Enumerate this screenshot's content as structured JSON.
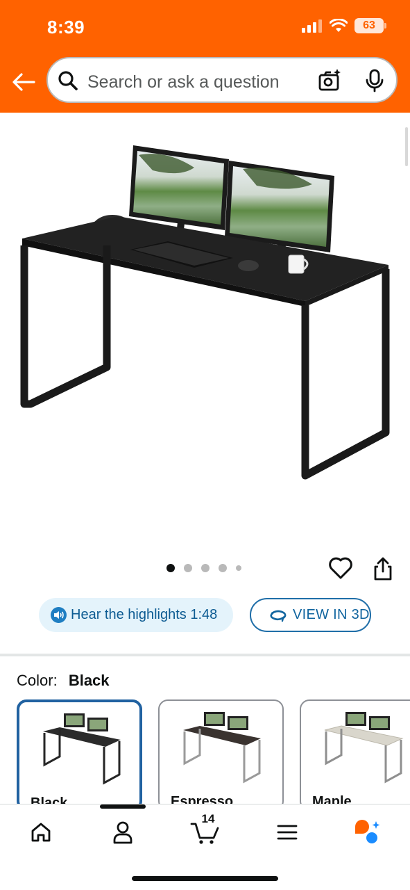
{
  "status_bar": {
    "time": "8:39",
    "battery": "63"
  },
  "header": {
    "background_color": "#ff6200",
    "search": {
      "placeholder": "Search or ask a question"
    },
    "icons": [
      "back-arrow-icon",
      "search-icon",
      "camera-icon",
      "mic-icon"
    ]
  },
  "product": {
    "image_icon": "desk-photo",
    "carousel": {
      "total": 5,
      "active_index": 0
    },
    "actions": [
      "heart-icon",
      "share-icon"
    ],
    "hear_highlights_label": "Hear the highlights 1:48",
    "view_3d_label": "VIEW IN 3D"
  },
  "color_selector": {
    "label": "Color:",
    "selected": "Black",
    "options": [
      {
        "label": "Black",
        "selected": true,
        "top_color": "#2b2b2b",
        "leg_color": "#262626"
      },
      {
        "label": "Espresso",
        "selected": false,
        "top_color": "#3a3330",
        "leg_color": "#9a9a9a"
      },
      {
        "label": "Maple",
        "selected": false,
        "top_color": "#d9d6cc",
        "leg_color": "#8f8f8f"
      }
    ]
  },
  "bottom_nav": {
    "cart_count": "14",
    "items": [
      "home-icon",
      "account-icon",
      "cart-icon",
      "menu-icon",
      "rufus-icon"
    ],
    "active": "account-icon"
  },
  "colors": {
    "accent_blue": "#2162a1",
    "link_blue": "#11659f",
    "text": "#0f1111"
  }
}
